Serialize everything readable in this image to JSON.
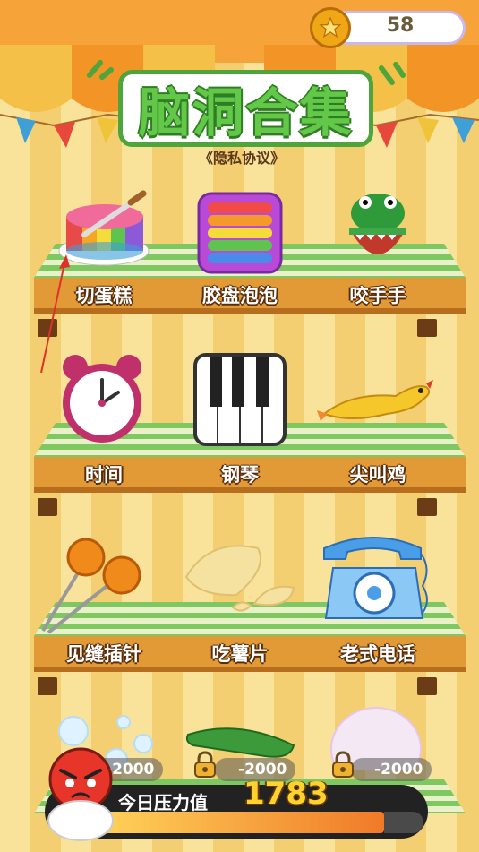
{
  "coins": {
    "value": "58"
  },
  "title": "脑洞合集",
  "privacy_link": "《隐私协议》",
  "shelves": [
    {
      "items": [
        {
          "label": "切蛋糕",
          "icon": "cake-icon"
        },
        {
          "label": "胶盘泡泡",
          "icon": "pop-it-icon"
        },
        {
          "label": "咬手手",
          "icon": "crocodile-icon"
        }
      ]
    },
    {
      "items": [
        {
          "label": "时间",
          "icon": "alarm-clock-icon"
        },
        {
          "label": "钢琴",
          "icon": "piano-icon"
        },
        {
          "label": "尖叫鸡",
          "icon": "rubber-chicken-icon"
        }
      ]
    },
    {
      "items": [
        {
          "label": "见缝插针",
          "icon": "pins-icon"
        },
        {
          "label": "吃薯片",
          "icon": "chips-icon"
        },
        {
          "label": "老式电话",
          "icon": "telephone-icon"
        }
      ]
    }
  ],
  "locked": [
    {
      "price": "2000",
      "icon": "bubbles-icon"
    },
    {
      "price": "2000",
      "icon": "cucumber-icon"
    },
    {
      "price": "2000",
      "icon": "soap-bubble-icon"
    }
  ],
  "stress": {
    "label": "今日压力值",
    "value": "1783",
    "level": 0.88
  },
  "colors": {
    "accent_green": "#63c84a",
    "shelf_wood": "#e29a37",
    "coin": "#f0a716"
  }
}
